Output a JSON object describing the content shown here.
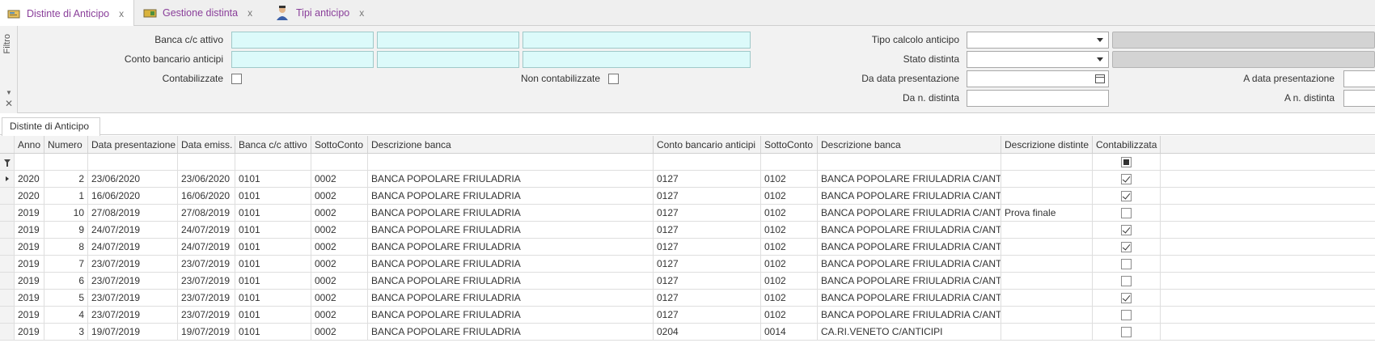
{
  "tabs": [
    {
      "label": "Distinte di Anticipo",
      "close": "x",
      "icon": "bank-slip-icon",
      "active": true
    },
    {
      "label": "Gestione distinta",
      "close": "x",
      "icon": "slip-folder-icon",
      "active": false
    },
    {
      "label": "Tipi anticipo",
      "close": "x",
      "icon": "person-icon",
      "active": false
    }
  ],
  "filter": {
    "side_label": "Filtro",
    "labels": {
      "banca_attivo": "Banca c/c attivo",
      "conto_anticipi": "Conto bancario anticipi",
      "contabilizzate": "Contabilizzate",
      "non_contabilizzate": "Non contabilizzate",
      "tipo_calcolo": "Tipo calcolo anticipo",
      "stato_distinta": "Stato distinta",
      "da_data": "Da data presentazione",
      "a_data": "A data presentazione",
      "da_numero": "Da n. distinta",
      "a_numero": "A n. distinta"
    }
  },
  "grid": {
    "tab_label": "Distinte di Anticipo",
    "columns": [
      "Anno",
      "Numero",
      "Data presentazione",
      "Data emiss.",
      "Banca c/c attivo",
      "SottoConto",
      "Descrizione banca",
      "Conto bancario anticipi",
      "SottoConto",
      "Descrizione banca",
      "Descrizione distinte",
      "Contabilizzata"
    ],
    "rows": [
      {
        "anno": "2020",
        "numero": "2",
        "data_pres": "23/06/2020",
        "data_emiss": "23/06/2020",
        "banca": "0101",
        "sottoconto": "0002",
        "desc_banca": "BANCA POPOLARE FRIULADRIA",
        "conto_ant": "0127",
        "sottoconto2": "0102",
        "desc_banca2": "BANCA POPOLARE FRIULADRIA C/ANTIC",
        "desc_distinta": "",
        "contabilizzata": true,
        "current": true
      },
      {
        "anno": "2020",
        "numero": "1",
        "data_pres": "16/06/2020",
        "data_emiss": "16/06/2020",
        "banca": "0101",
        "sottoconto": "0002",
        "desc_banca": "BANCA POPOLARE FRIULADRIA",
        "conto_ant": "0127",
        "sottoconto2": "0102",
        "desc_banca2": "BANCA POPOLARE FRIULADRIA C/ANTIC",
        "desc_distinta": "",
        "contabilizzata": true
      },
      {
        "anno": "2019",
        "numero": "10",
        "data_pres": "27/08/2019",
        "data_emiss": "27/08/2019",
        "banca": "0101",
        "sottoconto": "0002",
        "desc_banca": "BANCA POPOLARE FRIULADRIA",
        "conto_ant": "0127",
        "sottoconto2": "0102",
        "desc_banca2": "BANCA POPOLARE FRIULADRIA C/ANTIC",
        "desc_distinta": "Prova finale",
        "contabilizzata": false
      },
      {
        "anno": "2019",
        "numero": "9",
        "data_pres": "24/07/2019",
        "data_emiss": "24/07/2019",
        "banca": "0101",
        "sottoconto": "0002",
        "desc_banca": "BANCA POPOLARE FRIULADRIA",
        "conto_ant": "0127",
        "sottoconto2": "0102",
        "desc_banca2": "BANCA POPOLARE FRIULADRIA C/ANTIC",
        "desc_distinta": "",
        "contabilizzata": true
      },
      {
        "anno": "2019",
        "numero": "8",
        "data_pres": "24/07/2019",
        "data_emiss": "24/07/2019",
        "banca": "0101",
        "sottoconto": "0002",
        "desc_banca": "BANCA POPOLARE FRIULADRIA",
        "conto_ant": "0127",
        "sottoconto2": "0102",
        "desc_banca2": "BANCA POPOLARE FRIULADRIA C/ANTIC",
        "desc_distinta": "",
        "contabilizzata": true
      },
      {
        "anno": "2019",
        "numero": "7",
        "data_pres": "23/07/2019",
        "data_emiss": "23/07/2019",
        "banca": "0101",
        "sottoconto": "0002",
        "desc_banca": "BANCA POPOLARE FRIULADRIA",
        "conto_ant": "0127",
        "sottoconto2": "0102",
        "desc_banca2": "BANCA POPOLARE FRIULADRIA C/ANTIC",
        "desc_distinta": "",
        "contabilizzata": false
      },
      {
        "anno": "2019",
        "numero": "6",
        "data_pres": "23/07/2019",
        "data_emiss": "23/07/2019",
        "banca": "0101",
        "sottoconto": "0002",
        "desc_banca": "BANCA POPOLARE FRIULADRIA",
        "conto_ant": "0127",
        "sottoconto2": "0102",
        "desc_banca2": "BANCA POPOLARE FRIULADRIA C/ANTIC",
        "desc_distinta": "",
        "contabilizzata": false
      },
      {
        "anno": "2019",
        "numero": "5",
        "data_pres": "23/07/2019",
        "data_emiss": "23/07/2019",
        "banca": "0101",
        "sottoconto": "0002",
        "desc_banca": "BANCA POPOLARE FRIULADRIA",
        "conto_ant": "0127",
        "sottoconto2": "0102",
        "desc_banca2": "BANCA POPOLARE FRIULADRIA C/ANTIC",
        "desc_distinta": "",
        "contabilizzata": true
      },
      {
        "anno": "2019",
        "numero": "4",
        "data_pres": "23/07/2019",
        "data_emiss": "23/07/2019",
        "banca": "0101",
        "sottoconto": "0002",
        "desc_banca": "BANCA POPOLARE FRIULADRIA",
        "conto_ant": "0127",
        "sottoconto2": "0102",
        "desc_banca2": "BANCA POPOLARE FRIULADRIA C/ANTIC",
        "desc_distinta": "",
        "contabilizzata": false
      },
      {
        "anno": "2019",
        "numero": "3",
        "data_pres": "19/07/2019",
        "data_emiss": "19/07/2019",
        "banca": "0101",
        "sottoconto": "0002",
        "desc_banca": "BANCA POPOLARE FRIULADRIA",
        "conto_ant": "0204",
        "sottoconto2": "0014",
        "desc_banca2": "CA.RI.VENETO C/ANTICIPI",
        "desc_distinta": "",
        "contabilizzata": false
      }
    ]
  },
  "colors": {
    "accent": "#8a3f9a",
    "input_highlight": "#dcfafa",
    "panel": "#f2f2f2"
  }
}
